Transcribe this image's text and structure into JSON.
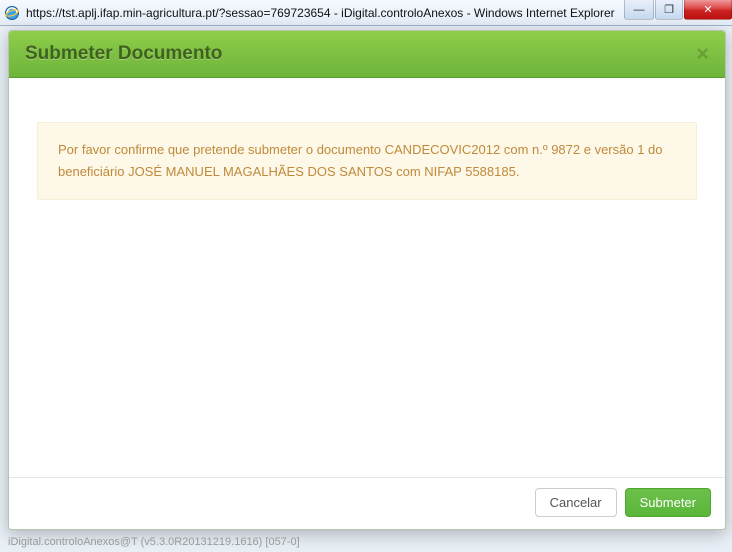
{
  "browser": {
    "title": "https://tst.aplj.ifap.min-agricultura.pt/?sessao=769723654 - iDigital.controloAnexos - Windows Internet Explorer"
  },
  "modal": {
    "title": "Submeter Documento",
    "close_glyph": "×",
    "alert_text": "Por favor confirme que pretende submeter o documento CANDECOVIC2012 com n.º 9872 e versão 1 do beneficiário JOSÉ MANUEL MAGALHÃES DOS SANTOS com NIFAP 5588185.",
    "cancel_label": "Cancelar",
    "submit_label": "Submeter"
  },
  "footer": {
    "status": "iDigital.controloAnexos@T (v5.3.0R20131219.1616) [057-0]"
  },
  "win": {
    "min": "—",
    "max": "❐",
    "close": "✕"
  }
}
